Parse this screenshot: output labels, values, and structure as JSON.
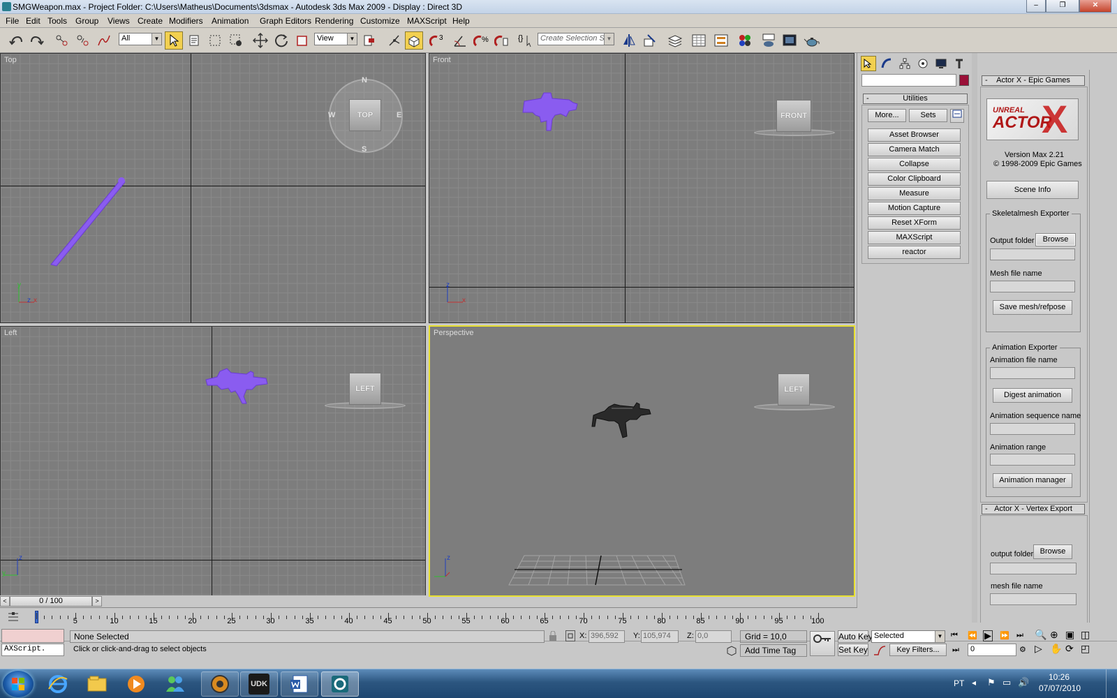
{
  "window": {
    "title": "SMGWeapon.max    - Project Folder: C:\\Users\\Matheus\\Documents\\3dsmax    - Autodesk 3ds Max  2009      - Display : Direct 3D",
    "minimize": "–",
    "maximize": "❐",
    "close": "✕"
  },
  "menu": [
    "File",
    "Edit",
    "Tools",
    "Group",
    "Views",
    "Create",
    "Modifiers",
    "Animation",
    "Graph Editors",
    "Rendering",
    "Customize",
    "MAXScript",
    "Help"
  ],
  "toolbar": {
    "filter_value": "All",
    "refcoord_value": "View",
    "selection_set_placeholder": "Create Selection Set",
    "snap_label": "3"
  },
  "viewports": {
    "top": {
      "label": "Top",
      "cube": "TOP",
      "compass": [
        "N",
        "S",
        "W",
        "E"
      ]
    },
    "front": {
      "label": "Front",
      "cube": "FRONT"
    },
    "left": {
      "label": "Left",
      "cube": "LEFT"
    },
    "perspective": {
      "label": "Perspective",
      "cube": "LEFT"
    },
    "axis_labels": {
      "x": "x",
      "y": "y",
      "z": "z"
    }
  },
  "command_panel": {
    "rollout_title": "Utilities",
    "more": "More...",
    "sets": "Sets",
    "utilities": [
      "Asset Browser",
      "Camera Match",
      "Collapse",
      "Color Clipboard",
      "Measure",
      "Motion Capture",
      "Reset XForm",
      "MAXScript",
      "reactor"
    ],
    "swatch_color": "#9a1038"
  },
  "actorx": {
    "rollout_title": "Actor X - Epic Games",
    "logo_top": "UNREAL",
    "logo_main": "ACTOR",
    "logo_x": "X",
    "version": "Version Max 2.21",
    "copyright": "© 1998-2009  Epic Games",
    "scene_info": "Scene Info",
    "skeletal_group": "Skeletalmesh Exporter",
    "output_folder": "Output folder",
    "browse": "Browse",
    "mesh_file_name": "Mesh file name",
    "save_mesh": "Save mesh/refpose",
    "anim_group": "Animation Exporter",
    "anim_file_name": "Animation file name",
    "digest": "Digest animation",
    "anim_seq_name": "Animation sequence name",
    "anim_range": "Animation range",
    "anim_manager": "Animation manager",
    "vertex_title": "Actor X - Vertex Export",
    "v_output_folder": "output folder",
    "v_browse": "Browse",
    "v_mesh_file_name": "mesh file name"
  },
  "timeline": {
    "frame_display": "0 / 100",
    "ticks": [
      "5",
      "10",
      "15",
      "20",
      "25",
      "30",
      "35",
      "40",
      "45",
      "50",
      "55",
      "60",
      "65",
      "70",
      "75",
      "80",
      "85",
      "90",
      "95",
      "100"
    ]
  },
  "status": {
    "script_label": "AXScript.",
    "selection": "None Selected",
    "prompt": "Click or click-and-drag to select objects",
    "x_label": "X:",
    "x_value": "396,592",
    "y_label": "Y:",
    "y_value": "105,974",
    "z_label": "Z:",
    "z_value": "0,0",
    "grid": "Grid = 10,0",
    "add_time_tag": "Add Time Tag",
    "auto_key": "Auto Key",
    "set_key": "Set Key",
    "key_mode": "Selected",
    "key_filters": "Key Filters...",
    "frame_value": "0"
  },
  "taskbar": {
    "udk": "UDK",
    "lang": "PT",
    "time": "10:26",
    "date": "07/07/2010"
  }
}
